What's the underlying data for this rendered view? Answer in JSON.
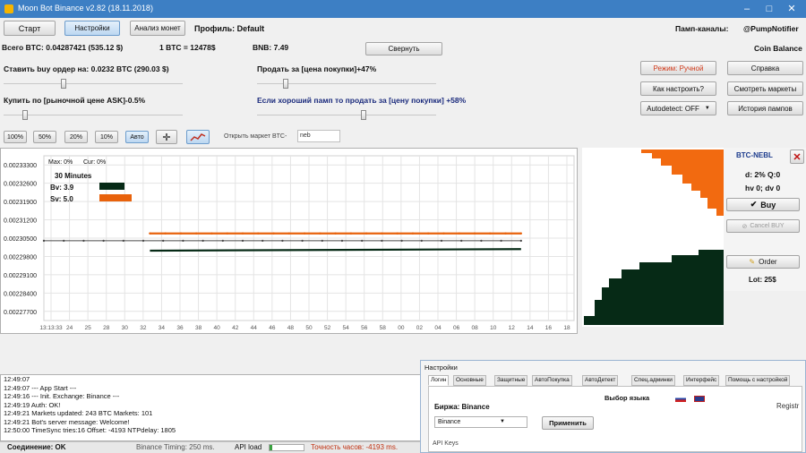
{
  "window": {
    "title": "Moon Bot Binance v2.82  (18.11.2018)",
    "minimize": "–",
    "maximize": "□",
    "close": "✕"
  },
  "toolbar": {
    "start_label": "Старт",
    "settings_label": "Настройки",
    "coin_analysis_label": "Анализ монет",
    "profile_label": "Профиль: Default",
    "pump_channels_label": "Памп-каналы:",
    "pump_channel_name": "@PumpNotifier",
    "coin_balance_label": "Coin Balance"
  },
  "balances": {
    "total_btc": "Всего BTC: 0.04287421 (535.12 $)",
    "btc_price": "1 BTC = 12478$",
    "bnb": "BNB: 7.49",
    "collapse_label": "Свернуть"
  },
  "orders": {
    "buy_order_label": "Ставить buy ордер на: 0.0232 BTC  (290.03 $)",
    "buy_market_label": "Купить по [рыночной цене ASK]-0.5%",
    "sell_label": "Продать за [цена покупки]+47%",
    "sell_pump_label": "Если хороший памп то продать за [цену покупки] +58%",
    "sliders": {
      "buy_order": 0.33,
      "buy_market": 0.11,
      "sell": 0.15,
      "sell_pump": 0.6
    }
  },
  "right_buttons": {
    "mode_manual": "Режим: Ручной",
    "help": "Справка",
    "how_to_setup": "Как настроить?",
    "view_markets": "Смотреть маркеты",
    "autodetect": "Autodetect: OFF",
    "pump_history": "История пампов"
  },
  "chart_toolbar": {
    "zoom": [
      "100%",
      "50%",
      "20%",
      "10%",
      "Авто"
    ],
    "open_market_label": "Открыть маркет BTC-",
    "market_input_value": "neb"
  },
  "chart_data": {
    "type": "line",
    "info": {
      "max": "Max: 0%",
      "cur": "Cur: 0%",
      "interval": "30 Minutes",
      "bv": "Bv: 3.9",
      "sv": "Sv: 5.0"
    },
    "yticks": [
      "0.00233300",
      "0.00232600",
      "0.00231900",
      "0.00231200",
      "0.00230500",
      "0.00229800",
      "0.00229100",
      "0.00228400",
      "0.00227700"
    ],
    "ylim": [
      0.0022735,
      0.0023365
    ],
    "xticks": [
      "13:13:33",
      "24",
      "25",
      "28",
      "30",
      "32",
      "34",
      "36",
      "38",
      "40",
      "42",
      "44",
      "46",
      "48",
      "50",
      "52",
      "54",
      "56",
      "58",
      "00",
      "02",
      "04",
      "06",
      "08",
      "10",
      "12",
      "14",
      "16",
      "18"
    ],
    "series": [
      {
        "color": "#e8620c",
        "x": [
          0.2,
          0.9
        ],
        "values": [
          0.0023068,
          0.0023068
        ]
      },
      {
        "color": "#4a4a4a",
        "x": [
          0.0,
          0.9
        ],
        "values": [
          0.002304,
          0.002304
        ]
      },
      {
        "color": "#062a16",
        "x": [
          0.2,
          0.9
        ],
        "values": [
          0.0023002,
          0.0023008
        ]
      }
    ]
  },
  "depth_panel": {
    "pair": "BTC-NEBL",
    "stats1": "d: 2% Q:0",
    "stats2": "hv 0; dv 0",
    "buy_label": "Buy",
    "cancel_buy_label": "Cancel BUY",
    "order_label": "Order",
    "lot_label": "Lot: 25$",
    "close_icon": "✕",
    "ask_color": "#f26a10",
    "bid_color": "#062a16"
  },
  "log": [
    "12:49:07",
    "12:49:07      --- App Start ---",
    "12:49:16      --- Init. Exchange: Binance ---",
    "12:49:19  Auth: OK!",
    "12:49:21  Markets updated: 243  BTC Markets: 101",
    "12:49:21  Bot's server message: Welcome!",
    "12:50:00  TimeSync tries:16  Offset: -4193  NTPdelay: 1805"
  ],
  "status": {
    "connection": "Соединение: OK",
    "timing": "Binance Timing: 250 ms.",
    "api_load": "API load",
    "api_load_fraction": 0.08,
    "clock_accuracy": "Точность часов: -4193 ms."
  },
  "settings_window": {
    "title": "Настройки",
    "tabs": [
      "Логин",
      "Основные",
      "Защитные",
      "АвтоПокупка",
      "АвтоДетект",
      "Спец.админки",
      "Интерфейс",
      "Помощь с настройкой"
    ],
    "language_label": "Выбор языка",
    "exchange_label": "Биржа: Binance",
    "exchange_select_value": "Binance",
    "apply_label": "Применить",
    "api_keys_label": "API Keys",
    "register_label": "Registr"
  }
}
